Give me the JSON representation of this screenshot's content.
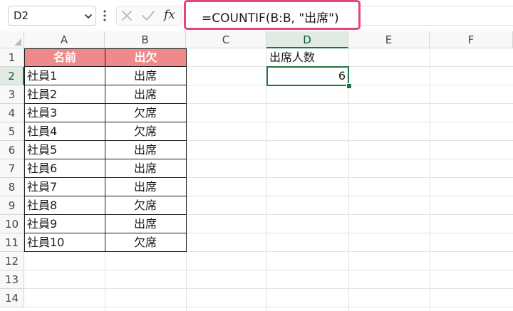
{
  "formula_bar": {
    "name_box": "D2",
    "fx_label": "fx",
    "formula": "=COUNTIF(B:B, \"出席\")",
    "highlight_color": "#e6457a"
  },
  "columns": [
    "A",
    "B",
    "C",
    "D",
    "E",
    "F"
  ],
  "rows": [
    "1",
    "2",
    "3",
    "4",
    "5",
    "6",
    "7",
    "8",
    "9",
    "10",
    "11",
    "12",
    "13",
    "14"
  ],
  "table": {
    "header_color": "#f0898a",
    "headers": [
      "名前",
      "出欠"
    ],
    "rows": [
      [
        "社員1",
        "出席"
      ],
      [
        "社員2",
        "出席"
      ],
      [
        "社員3",
        "欠席"
      ],
      [
        "社員4",
        "欠席"
      ],
      [
        "社員5",
        "出席"
      ],
      [
        "社員6",
        "出席"
      ],
      [
        "社員7",
        "出席"
      ],
      [
        "社員8",
        "欠席"
      ],
      [
        "社員9",
        "出席"
      ],
      [
        "社員10",
        "欠席"
      ]
    ]
  },
  "d1": "出席人数",
  "d2": "6",
  "selected_cell": "D2",
  "accent_color": "#217346"
}
